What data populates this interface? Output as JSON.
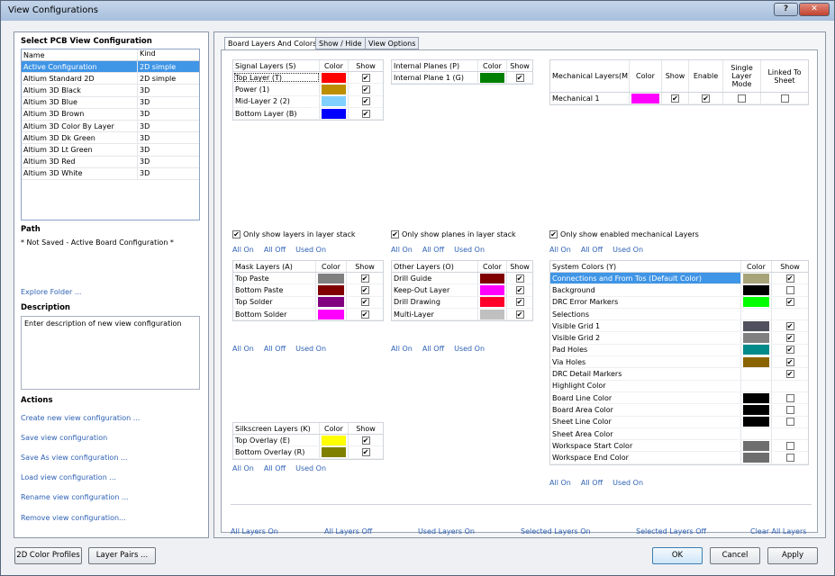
{
  "window": {
    "title": "View Configurations",
    "help": "?",
    "close": "✕"
  },
  "left": {
    "section_title": "Select PCB View Configuration",
    "table_headers": [
      "Name",
      "Kind"
    ],
    "configs": [
      {
        "name": "Active Configuration",
        "kind": "2D simple"
      },
      {
        "name": "Altium Standard 2D",
        "kind": "2D simple"
      },
      {
        "name": "Altium 3D Black",
        "kind": "3D"
      },
      {
        "name": "Altium 3D Blue",
        "kind": "3D"
      },
      {
        "name": "Altium 3D Brown",
        "kind": "3D"
      },
      {
        "name": "Altium 3D Color By Layer",
        "kind": "3D"
      },
      {
        "name": "Altium 3D Dk Green",
        "kind": "3D"
      },
      {
        "name": "Altium 3D Lt Green",
        "kind": "3D"
      },
      {
        "name": "Altium 3D Red",
        "kind": "3D"
      },
      {
        "name": "Altium 3D White",
        "kind": "3D"
      }
    ],
    "path_title": "Path",
    "path_value": "* Not Saved - Active Board Configuration *",
    "explore_folder": "Explore Folder ...",
    "description_title": "Description",
    "description_value": "Enter description of new view configuration",
    "actions_title": "Actions",
    "actions": [
      "Create new view configuration ...",
      "Save view configuration",
      "Save As view configuration ...",
      "Load view configuration ...",
      "Rename view configuration ...",
      "Remove view configuration..."
    ]
  },
  "tabs": [
    "Board Layers And Colors",
    "Show / Hide",
    "View Options"
  ],
  "signal": {
    "headers": [
      "Signal Layers (S)",
      "Color",
      "Show"
    ],
    "rows": [
      {
        "name": "Top Layer (T)",
        "color": "#ff0000",
        "show": true
      },
      {
        "name": "Power (1)",
        "color": "#bc8e00",
        "show": true
      },
      {
        "name": "Mid-Layer 2 (2)",
        "color": "#7fd0ff",
        "show": true
      },
      {
        "name": "Bottom Layer (B)",
        "color": "#0000ff",
        "show": true
      }
    ],
    "only_show": "Only show layers in layer stack",
    "only_checked": true
  },
  "internal": {
    "headers": [
      "Internal Planes (P)",
      "Color",
      "Show"
    ],
    "rows": [
      {
        "name": "Internal Plane 1 (G)",
        "color": "#008000",
        "show": true
      }
    ],
    "only_show": "Only show planes in layer stack",
    "only_checked": true
  },
  "mechanical": {
    "headers": [
      "Mechanical Layers(M)",
      "Color",
      "Show",
      "Enable",
      "Single Layer Mode",
      "Linked To Sheet"
    ],
    "rows": [
      {
        "name": "Mechanical 1",
        "color": "#ff00ff",
        "show": true,
        "enable": true,
        "single": false,
        "linked": false
      }
    ],
    "only_show": "Only show enabled mechanical Layers",
    "only_checked": true
  },
  "mask": {
    "headers": [
      "Mask Layers (A)",
      "Color",
      "Show"
    ],
    "rows": [
      {
        "name": "Top Paste",
        "color": "#808080",
        "show": true
      },
      {
        "name": "Bottom Paste",
        "color": "#800000",
        "show": true
      },
      {
        "name": "Top Solder",
        "color": "#800080",
        "show": true
      },
      {
        "name": "Bottom Solder",
        "color": "#ff00ff",
        "show": true
      }
    ]
  },
  "other": {
    "headers": [
      "Other Layers (O)",
      "Color",
      "Show"
    ],
    "rows": [
      {
        "name": "Drill Guide",
        "color": "#800000",
        "show": true
      },
      {
        "name": "Keep-Out Layer",
        "color": "#ff00ff",
        "show": true
      },
      {
        "name": "Drill Drawing",
        "color": "#ff002a",
        "show": true
      },
      {
        "name": "Multi-Layer",
        "color": "#c0c0c0",
        "show": true
      }
    ]
  },
  "system": {
    "headers": [
      "System Colors (Y)",
      "Color",
      "Show"
    ],
    "rows": [
      {
        "name": "Connections and From Tos (Default Color)",
        "color": "#a8a47a",
        "show": true,
        "sel": true
      },
      {
        "name": "Background",
        "color": "#000000",
        "show": false
      },
      {
        "name": "DRC Error Markers",
        "color": "#00ff00",
        "show": true
      },
      {
        "name": "Selections",
        "color": "",
        "show": false
      },
      {
        "name": "Visible Grid 1",
        "color": "#50505e",
        "show": true
      },
      {
        "name": "Visible Grid 2",
        "color": "#808080",
        "show": true
      },
      {
        "name": "Pad Holes",
        "color": "#008a8a",
        "show": true
      },
      {
        "name": "Via Holes",
        "color": "#8a6400",
        "show": true
      },
      {
        "name": "DRC Detail Markers",
        "color": "",
        "show": true
      },
      {
        "name": "Highlight Color",
        "color": "",
        "show": false
      },
      {
        "name": "Board Line Color",
        "color": "#000000",
        "show": false
      },
      {
        "name": "Board Area Color",
        "color": "#000000",
        "show": false
      },
      {
        "name": "Sheet Line Color",
        "color": "#000000",
        "show": false
      },
      {
        "name": "Sheet Area Color",
        "color": "",
        "show": false
      },
      {
        "name": "Workspace Start Color",
        "color": "#6e6e6e",
        "show": false
      },
      {
        "name": "Workspace End Color",
        "color": "#6e6e6e",
        "show": false
      }
    ]
  },
  "silk": {
    "headers": [
      "Silkscreen Layers (K)",
      "Color",
      "Show"
    ],
    "rows": [
      {
        "name": "Top Overlay (E)",
        "color": "#ffff00",
        "show": true
      },
      {
        "name": "Bottom Overlay (R)",
        "color": "#808000",
        "show": true
      }
    ]
  },
  "link_labels": {
    "all_on": "All On",
    "all_off": "All Off",
    "used_on": "Used On"
  },
  "bottom_links": [
    "All Layers On",
    "All Layers Off",
    "Used Layers On",
    "Selected Layers On",
    "Selected Layers Off",
    "Clear All Layers"
  ],
  "buttons": {
    "color_profiles": "2D Color Profiles",
    "layer_pairs": "Layer Pairs ...",
    "ok": "OK",
    "cancel": "Cancel",
    "apply": "Apply"
  }
}
